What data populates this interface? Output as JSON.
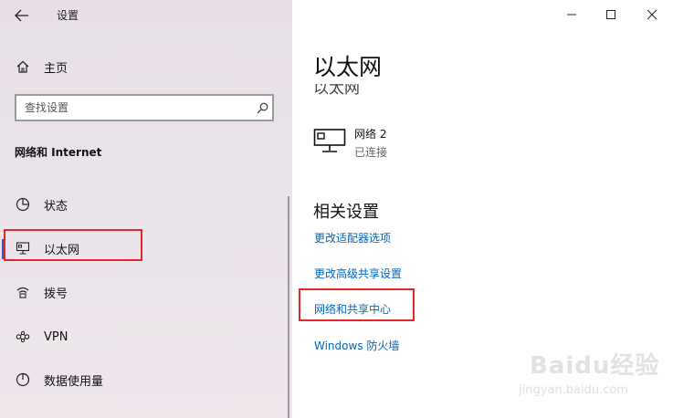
{
  "window": {
    "app_title": "设置",
    "controls": {
      "minimize": "minimize",
      "maximize": "maximize",
      "close": "close"
    }
  },
  "sidebar": {
    "home_label": "主页",
    "search_placeholder": "查找设置",
    "section_heading": "网络和 Internet",
    "items": [
      {
        "label": "状态",
        "icon": "status-icon",
        "selected": false
      },
      {
        "label": "以太网",
        "icon": "ethernet-icon",
        "selected": true
      },
      {
        "label": "拨号",
        "icon": "dialup-icon",
        "selected": false
      },
      {
        "label": "VPN",
        "icon": "vpn-icon",
        "selected": false
      },
      {
        "label": "数据使用量",
        "icon": "data-usage-icon",
        "selected": false
      }
    ]
  },
  "main": {
    "page_title": "以太网",
    "ghost_title": "以太网",
    "network": {
      "name": "网络 2",
      "status": "已连接",
      "icon": "ethernet-icon"
    },
    "related_heading": "相关设置",
    "links": [
      "更改适配器选项",
      "更改高级共享设置",
      "网络和共享中心",
      "Windows 防火墙"
    ]
  },
  "watermark": {
    "brand": "Baidu经验",
    "url": "jingyan.baidu.com"
  },
  "colors": {
    "accent": "#0067c0",
    "highlight": "#e5262b",
    "selection_bar": "#2a5fbf"
  }
}
